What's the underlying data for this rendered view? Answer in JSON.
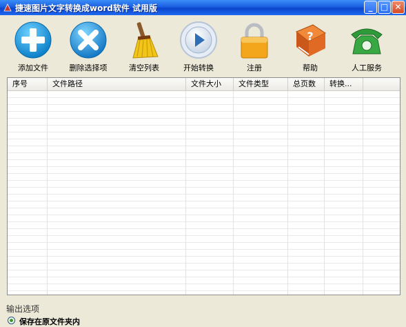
{
  "window": {
    "title": "捷速图片文字转换成word软件 试用版",
    "controls": {
      "minimize": "_",
      "maximize": "□",
      "close": "✕"
    }
  },
  "toolbar": {
    "items": [
      {
        "label": "添加文件",
        "icon": "add-icon"
      },
      {
        "label": "删除选择项",
        "icon": "delete-icon"
      },
      {
        "label": "清空列表",
        "icon": "broom-icon"
      },
      {
        "label": "开始转换",
        "icon": "play-icon"
      },
      {
        "label": "注册",
        "icon": "lock-icon"
      },
      {
        "label": "帮助",
        "icon": "help-book-icon"
      },
      {
        "label": "人工服务",
        "icon": "phone-icon"
      }
    ]
  },
  "file_list": {
    "columns": [
      "序号",
      "文件路径",
      "文件大小",
      "文件类型",
      "总页数",
      "转换..."
    ],
    "rows": []
  },
  "output": {
    "section_title": "输出选项",
    "option_label": "保存在原文件夹内",
    "option_selected": true
  },
  "colors": {
    "titlebar": "#1b5fe0",
    "window_bg": "#ece9d8",
    "add": "#1a9fe6",
    "delete": "#2a8fd8",
    "lock": "#f3a51b",
    "help": "#e07b2a",
    "phone": "#2f9a3a"
  }
}
